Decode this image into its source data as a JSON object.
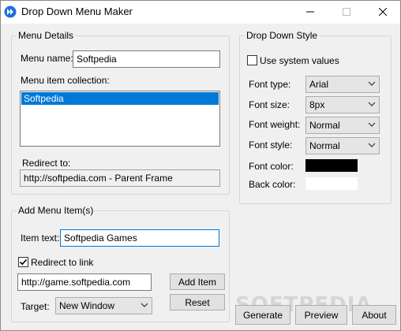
{
  "window": {
    "title": "Drop Down Menu Maker",
    "icon": "app-double-arrow-icon"
  },
  "menu_details": {
    "legend": "Menu Details",
    "menu_name_label": "Menu name:",
    "menu_name_value": "Softpedia",
    "collection_label": "Menu item collection:",
    "collection_items": [
      "Softpedia"
    ],
    "redirect_label": "Redirect to:",
    "redirect_value": "http://softpedia.com - Parent Frame"
  },
  "add_menu_item": {
    "legend": "Add Menu Item(s)",
    "item_text_label": "Item text:",
    "item_text_value": "Softpedia Games",
    "redirect_checkbox_label": "Redirect to link",
    "redirect_checked": true,
    "url_value": "http://game.softpedia.com",
    "target_label": "Target:",
    "target_value": "New Window",
    "add_button": "Add Item",
    "reset_button": "Reset"
  },
  "drop_down_style": {
    "legend": "Drop Down Style",
    "use_system_label": "Use system values",
    "use_system_checked": false,
    "font_type_label": "Font type:",
    "font_type_value": "Arial",
    "font_size_label": "Font size:",
    "font_size_value": "8px",
    "font_weight_label": "Font weight:",
    "font_weight_value": "Normal",
    "font_style_label": "Font style:",
    "font_style_value": "Normal",
    "font_color_label": "Font color:",
    "font_color": "#000000",
    "back_color_label": "Back color:",
    "back_color": "#ffffff"
  },
  "actions": {
    "generate": "Generate",
    "preview": "Preview",
    "about": "About"
  },
  "watermark": "SOFTPEDIA"
}
